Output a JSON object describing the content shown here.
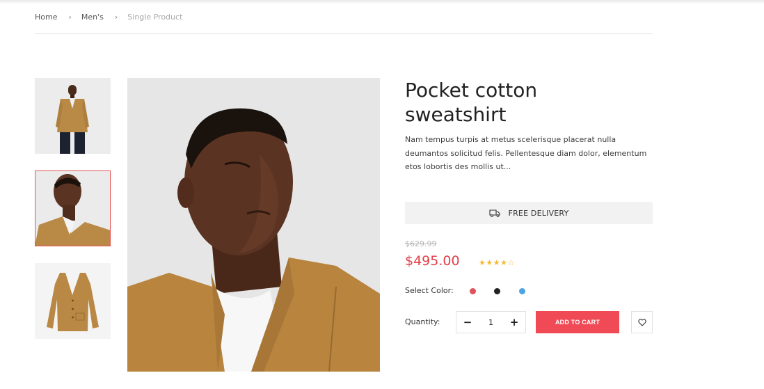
{
  "breadcrumb": {
    "items": [
      "Home",
      "Men's",
      "Single Product"
    ]
  },
  "product": {
    "title": "Pocket cotton sweatshirt",
    "description": "Nam tempus turpis at metus scelerisque placerat nulla deumantos solicitud felis. Pellentesque diam dolor, elementum etos lobortis des mollis ut...",
    "delivery_label": "FREE DELIVERY",
    "old_price": "$629.99",
    "price": "$495.00",
    "rating": 4,
    "rating_max": 5,
    "select_color_label": "Select Color:",
    "colors": [
      "#e0525a",
      "#222222",
      "#4ea3e3"
    ],
    "quantity_label": "Quantity:",
    "quantity": "1",
    "add_to_cart_label": "ADD TO CART",
    "minus_symbol": "−",
    "plus_symbol": "+"
  },
  "icons": {
    "delivery": "truck-icon",
    "wishlist": "heart-icon",
    "breadcrumb_separator": "chevron-right-icon"
  },
  "colors": {
    "accent": "#ef4a56",
    "price": "#e2404a",
    "star": "#f5b82e",
    "active_thumb_border": "#e65050"
  }
}
